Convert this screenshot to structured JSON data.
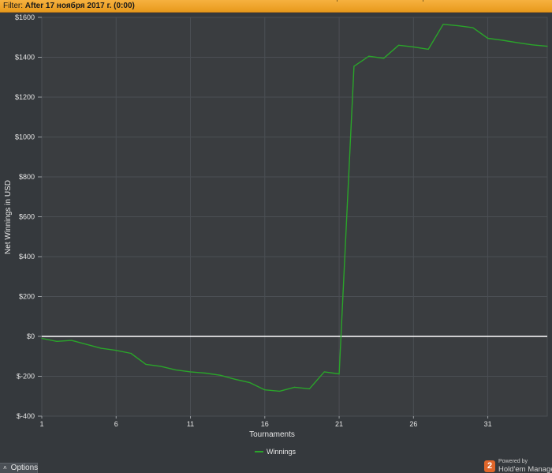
{
  "filter": {
    "label": "Filter: ",
    "value": "After 17 ноября 2017 г. (0:00)"
  },
  "chart_data": {
    "type": "line",
    "xlabel": "Tournaments",
    "ylabel": "Net Winnings in USD",
    "x_ticks": [
      1,
      6,
      11,
      16,
      21,
      26,
      31
    ],
    "x_range": [
      1,
      35
    ],
    "y_ticks": [
      -400,
      -200,
      0,
      200,
      400,
      600,
      800,
      1000,
      1200,
      1400,
      1600
    ],
    "y_tick_labels": [
      "$-400",
      "$-200",
      "$0",
      "$200",
      "$400",
      "$600",
      "$800",
      "$1000",
      "$1200",
      "$1400",
      "$1600"
    ],
    "ylim": [
      -400,
      1600
    ],
    "grid": true,
    "zero_line": true,
    "legend_position": "bottom-center",
    "series": [
      {
        "name": "Winnings",
        "color": "#2aa52a",
        "x": [
          1,
          2,
          3,
          4,
          5,
          6,
          7,
          8,
          9,
          10,
          11,
          12,
          13,
          14,
          15,
          16,
          17,
          18,
          19,
          20,
          21,
          22,
          23,
          24,
          25,
          26,
          27,
          28,
          29,
          30,
          31,
          32,
          33,
          34,
          35
        ],
        "y": [
          -10,
          -25,
          -20,
          -40,
          -60,
          -70,
          -85,
          -140,
          -150,
          -168,
          -178,
          -184,
          -195,
          -215,
          -232,
          -268,
          -275,
          -255,
          -263,
          -178,
          -188,
          1355,
          1405,
          1395,
          1460,
          1452,
          1440,
          1565,
          1558,
          1548,
          1495,
          1485,
          1473,
          1462,
          1455
        ]
      }
    ]
  },
  "options": {
    "label": "Options"
  },
  "brand": {
    "logo_char": "2",
    "powered_by": "Powered by",
    "name": "Hold'em Manager"
  }
}
